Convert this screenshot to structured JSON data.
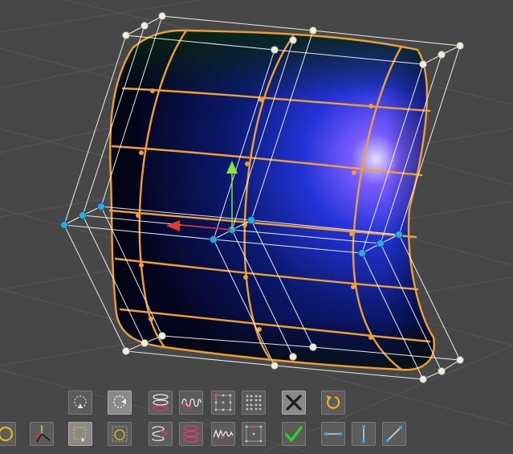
{
  "app": {
    "view": "3d-viewport"
  },
  "colors": {
    "background": "#474747",
    "grid": "#5a5a5a",
    "cage": "#ffffff",
    "surface_wire": "#f0a030",
    "surface_fill_dark": "#08083a",
    "surface_fill_light": "#2a3cff",
    "selected_point": "#2aa8e8",
    "gizmo_x": "#e03a2a",
    "gizmo_y": "#8ce03a",
    "accept": "#2ed02e"
  },
  "toolbar": {
    "row1": [
      {
        "id": "loop-select-vertical",
        "icon": "loop-arrow-icon",
        "active": false
      },
      {
        "id": "loop-select-horizontal",
        "icon": "loop-arrow-icon",
        "active": true
      },
      {
        "id": "rings-vertical",
        "icon": "rings-icon",
        "active": false
      },
      {
        "id": "coil-spiral",
        "icon": "coil-icon",
        "active": false
      },
      {
        "id": "grid-points-corner",
        "icon": "grid-corner-icon",
        "active": false
      },
      {
        "id": "grid-points-all",
        "icon": "grid-all-icon",
        "active": false
      },
      {
        "id": "cancel",
        "icon": "close-icon",
        "active": true
      },
      {
        "id": "reset",
        "icon": "rotate-icon",
        "active": false
      }
    ],
    "row2": [
      {
        "id": "rotate-tool",
        "icon": "rotate-icon",
        "active": false
      },
      {
        "id": "move-gizmo",
        "icon": "axis-gizmo-icon",
        "active": false
      },
      {
        "id": "box-select",
        "icon": "box-select-icon",
        "active": true
      },
      {
        "id": "box-loop-select",
        "icon": "box-loop-icon",
        "active": false
      },
      {
        "id": "stacked-rings",
        "icon": "stack-rings-icon",
        "active": false
      },
      {
        "id": "stacked-coils",
        "icon": "stack-coils-icon",
        "active": false
      },
      {
        "id": "wave-curve",
        "icon": "wave-icon",
        "active": false
      },
      {
        "id": "grid-points-dots",
        "icon": "grid-dots-icon",
        "active": false
      },
      {
        "id": "accept",
        "icon": "checkmark-icon",
        "active": false
      },
      {
        "id": "align-horizontal",
        "icon": "align-horizontal-icon",
        "active": false
      },
      {
        "id": "align-vertical",
        "icon": "align-vertical-icon",
        "active": false
      },
      {
        "id": "align-diagonal",
        "icon": "align-diagonal-icon",
        "active": false
      }
    ]
  }
}
